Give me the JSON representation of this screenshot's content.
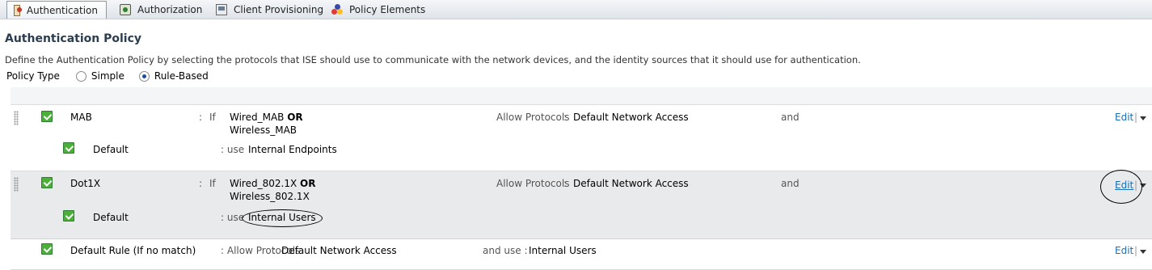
{
  "tabs": [
    {
      "label": "Authentication",
      "icon": "user-badge-icon",
      "active": true
    },
    {
      "label": "Authorization",
      "icon": "key-shield-icon",
      "active": false
    },
    {
      "label": "Client Provisioning",
      "icon": "monitor-icon",
      "active": false
    },
    {
      "label": "Policy Elements",
      "icon": "shapes-icon",
      "active": false
    }
  ],
  "page": {
    "title": "Authentication Policy",
    "description": "Define the Authentication Policy by selecting the protocols that ISE should use to communicate with the network devices, and the identity sources that it should use for authentication.",
    "policy_type_label": "Policy Type",
    "options": [
      "Simple",
      "Rule-Based"
    ],
    "selected": "Rule-Based"
  },
  "rules": {
    "mab": {
      "name": "MAB",
      "colon": ":",
      "if": "If",
      "cond1": "Wired_MAB",
      "or": "OR",
      "cond2": "Wireless_MAB",
      "allow_label": "Allow Protocols",
      "allow_colon": ":",
      "protocol": "Default Network Access",
      "and": "and",
      "edit": "Edit",
      "sep": "|",
      "default_name": "Default",
      "use_label": ": use",
      "identity_source": "Internal Endpoints"
    },
    "dot1x": {
      "name": "Dot1X",
      "colon": ":",
      "if": "If",
      "cond1": "Wired_802.1X",
      "or": "OR",
      "cond2": "Wireless_802.1X",
      "allow_label": "Allow Protocols",
      "allow_colon": ":",
      "protocol": "Default Network Access",
      "and": "and",
      "edit": "Edit",
      "sep": "|",
      "default_name": "Default",
      "use_label": ": use",
      "identity_source": "Internal Users"
    },
    "default_rule": {
      "name": "Default Rule (If no match)",
      "allow_label": ": Allow Protocols",
      "allow_colon": ":",
      "protocol": "Default Network Access",
      "and_use": "and use :",
      "identity_source": "Internal Users",
      "edit": "Edit",
      "sep": "|"
    }
  }
}
